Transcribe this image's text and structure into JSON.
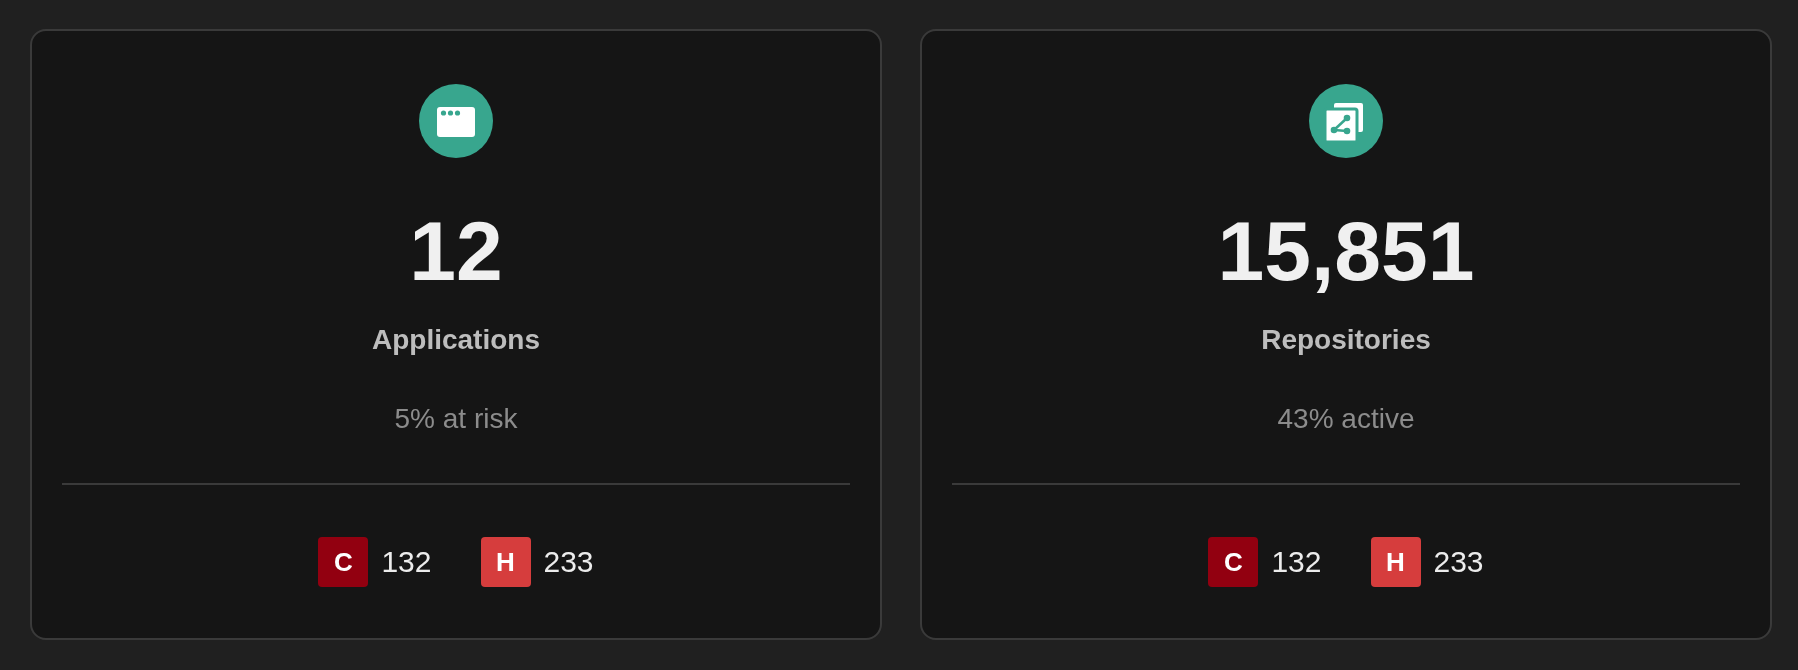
{
  "cards": [
    {
      "kind": "window",
      "value": "12",
      "label": "Applications",
      "subtitle": "5% at risk",
      "severities": [
        {
          "letter": "C",
          "count": "132",
          "color": "#920010"
        },
        {
          "letter": "H",
          "count": "233",
          "color": "#d63d3d"
        }
      ]
    },
    {
      "kind": "repository",
      "value": "15,851",
      "label": "Repositories",
      "subtitle": "43% active",
      "severities": [
        {
          "letter": "C",
          "count": "132",
          "color": "#920010"
        },
        {
          "letter": "H",
          "count": "233",
          "color": "#d63d3d"
        }
      ]
    }
  ]
}
